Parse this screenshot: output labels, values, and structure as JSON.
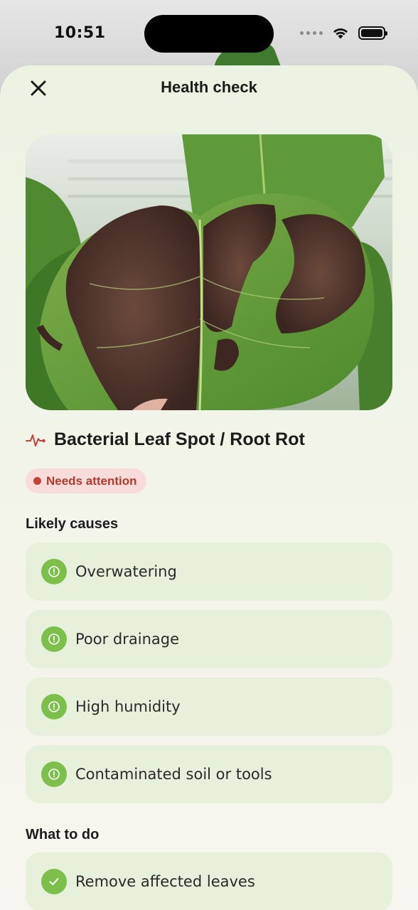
{
  "status_bar": {
    "time": "10:51"
  },
  "header": {
    "title": "Health check"
  },
  "diagnosis": {
    "title": "Bacterial Leaf Spot / Root Rot",
    "badge": "Needs attention"
  },
  "causes": {
    "heading": "Likely causes",
    "items": [
      {
        "label": "Overwatering"
      },
      {
        "label": "Poor drainage"
      },
      {
        "label": "High humidity"
      },
      {
        "label": "Contaminated soil or tools"
      }
    ]
  },
  "actions": {
    "heading": "What to do",
    "items": [
      {
        "label": "Remove affected leaves"
      }
    ]
  },
  "colors": {
    "accent_green": "#7cc04b",
    "card_bg": "#e6f0da",
    "alert_red": "#c4423a",
    "alert_bg": "#f7dcd9"
  },
  "icons": {
    "close": "close-icon",
    "heartbeat": "heartbeat-icon",
    "cause": "alert-circle-icon",
    "action": "check-circle-icon"
  }
}
